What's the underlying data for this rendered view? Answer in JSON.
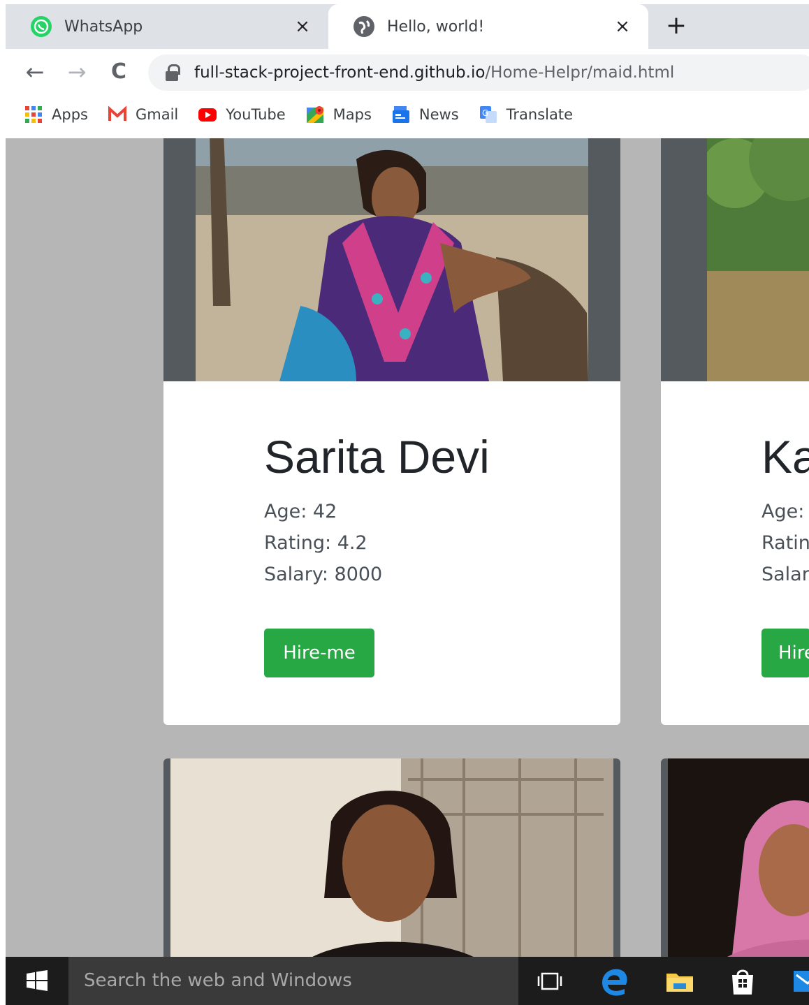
{
  "browser": {
    "tabs": [
      {
        "title": "WhatsApp",
        "active": false,
        "icon": "whatsapp-icon"
      },
      {
        "title": "Hello, world!",
        "active": true,
        "icon": "globe-icon"
      }
    ],
    "close_glyph": "×",
    "new_tab_glyph": "+",
    "nav": {
      "back": "←",
      "forward": "→",
      "reload": "C"
    },
    "url_host": "full-stack-project-front-end.github.io",
    "url_path": "/Home-Helpr/maid.html",
    "bookmarks": [
      "Apps",
      "Gmail",
      "YouTube",
      "Maps",
      "News",
      "Translate"
    ]
  },
  "cards": [
    {
      "name": "Sarita Devi",
      "age": "Age: 42",
      "rating": "Rating: 4.2",
      "salary": "Salary: 8000",
      "button": "Hire-me"
    },
    {
      "name": "Ka",
      "age": "Age:",
      "rating": "Ratin",
      "salary": "Salar",
      "button": "Hire"
    }
  ],
  "taskbar": {
    "search_placeholder": "Search the web and Windows"
  },
  "colors": {
    "page_bg": "#b6b6b6",
    "hire_button": "#28a745",
    "photo_frame": "#555a5e"
  }
}
